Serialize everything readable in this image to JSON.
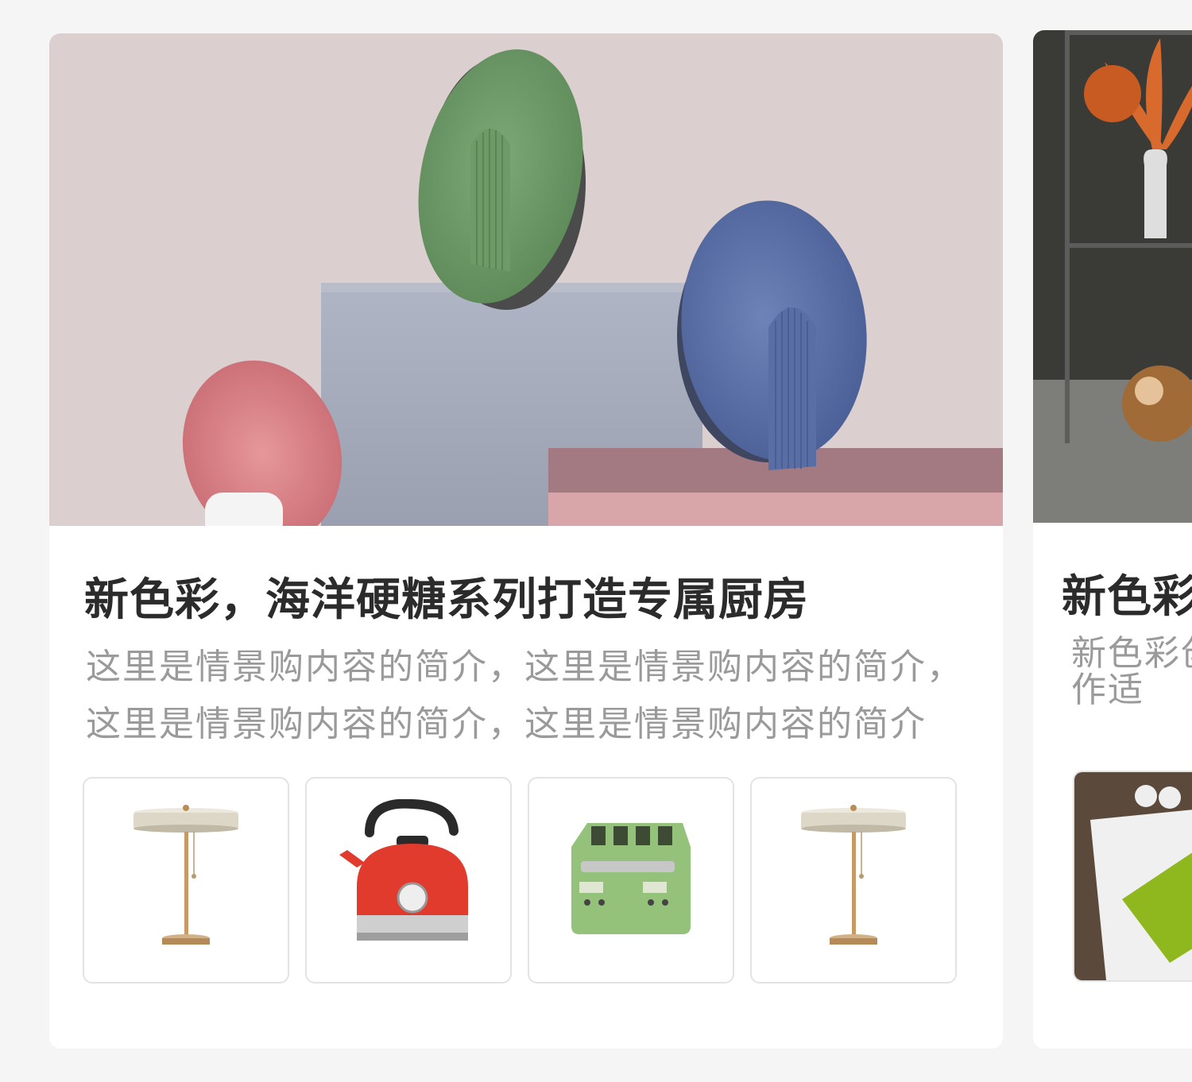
{
  "cards": [
    {
      "title": "新色彩，海洋硬糖系列打造专属厨房",
      "description": "这里是情景购内容的简介，这里是情景购内容的简介，这里是情景购内容的简介，这里是情景购内容的简介",
      "hero_icon": "ceramic-sculpture-scene",
      "products": [
        {
          "icon": "table-lamp-icon"
        },
        {
          "icon": "red-kettle-icon"
        },
        {
          "icon": "green-toaster-icon"
        },
        {
          "icon": "table-lamp-icon"
        }
      ]
    },
    {
      "title": "新色彩",
      "description": "新色彩创作适",
      "hero_icon": "interior-shelf-scene",
      "products": [
        {
          "icon": "green-furniture-icon"
        }
      ]
    }
  ],
  "colors": {
    "page_background": "#f5f5f5",
    "card_background": "#ffffff",
    "title_text": "#2b2b2b",
    "description_text": "#9a9a9a"
  }
}
